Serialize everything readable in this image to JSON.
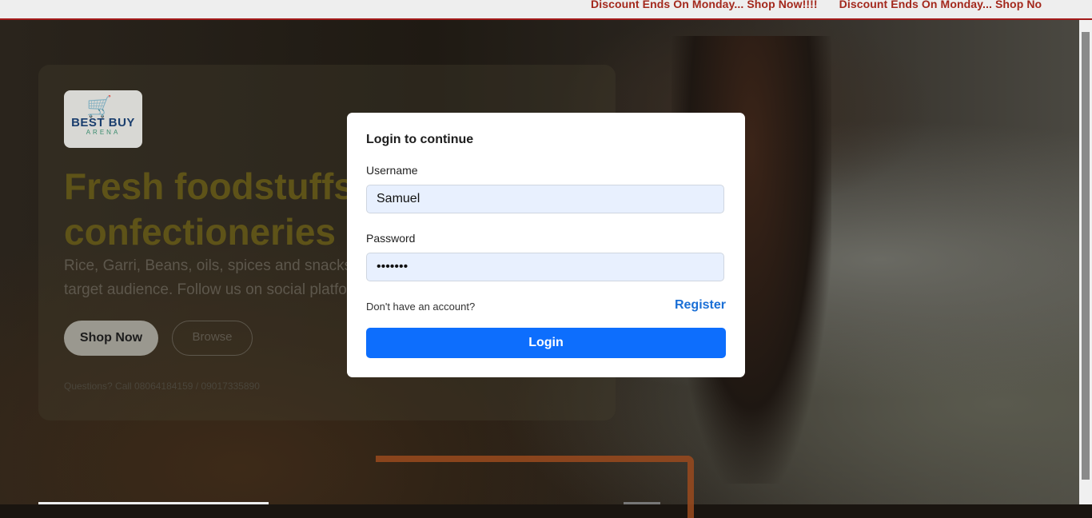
{
  "marquee": {
    "items": [
      "Discount Ends On Monday... Shop Now!!!!",
      "Discount Ends On Monday... Shop No"
    ]
  },
  "hero": {
    "logo_text": "BEST BUY",
    "logo_sub": "ARENA",
    "title_line1": "Fresh foodstuffs",
    "title_line2": "confectioneries",
    "desc_line1": "Rice, Garri, Beans, oils, spices and snacks —",
    "desc_line2": "target audience. Follow us on social platfor",
    "shop_label": "Shop Now",
    "browse_label": "Browse",
    "contact": "Questions? Call 08064184159 / 09017335890"
  },
  "login": {
    "title": "Login to continue",
    "username_label": "Username",
    "username_value": "Samuel",
    "password_label": "Password",
    "password_value": "1234567",
    "account_prompt": "Don't have an account?",
    "register_label": "Register",
    "login_label": "Login"
  },
  "colors": {
    "accent": "#0d6efd",
    "marquee_text": "#a3281c",
    "link": "#1a6fd6"
  }
}
